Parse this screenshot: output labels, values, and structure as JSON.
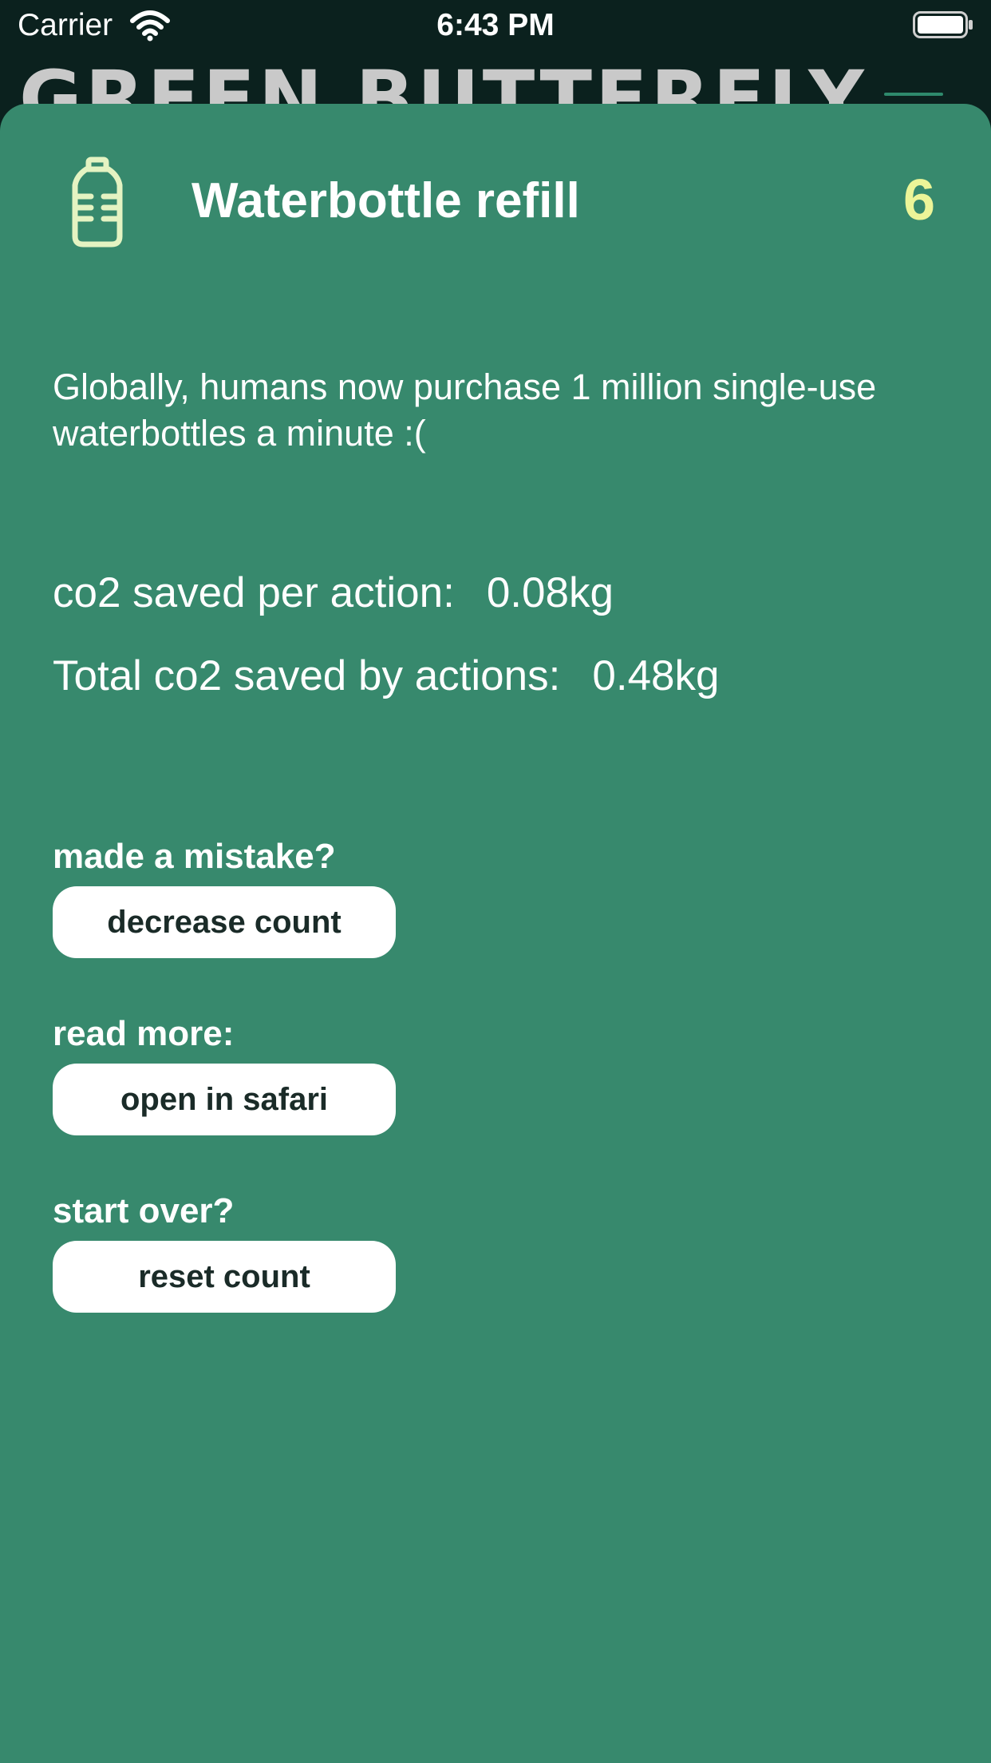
{
  "status_bar": {
    "carrier": "Carrier",
    "time": "6:43 PM",
    "wifi_icon": "wifi-icon",
    "battery_icon": "battery-icon"
  },
  "background": {
    "app_title": "GREEN BUTTERFLY"
  },
  "sheet": {
    "icon": "water-bottle-icon",
    "title": "Waterbottle refill",
    "count": "6",
    "fact": "Globally, humans now purchase 1 million single-use waterbottles a minute :(",
    "stats": {
      "per_action_label": "co2 saved per action:",
      "per_action_value": "0.08kg",
      "total_label": "Total co2 saved by actions:",
      "total_value": "0.48kg"
    },
    "sections": {
      "mistake_label": "made a mistake?",
      "decrease_button": "decrease count",
      "read_label": "read more:",
      "safari_button": "open in safari",
      "start_label": "start over?",
      "reset_button": "reset count"
    }
  },
  "colors": {
    "sheet_bg": "#37896d",
    "count": "#ecf598",
    "icon": "#e4f3c2",
    "status_bg": "#0b211e"
  }
}
